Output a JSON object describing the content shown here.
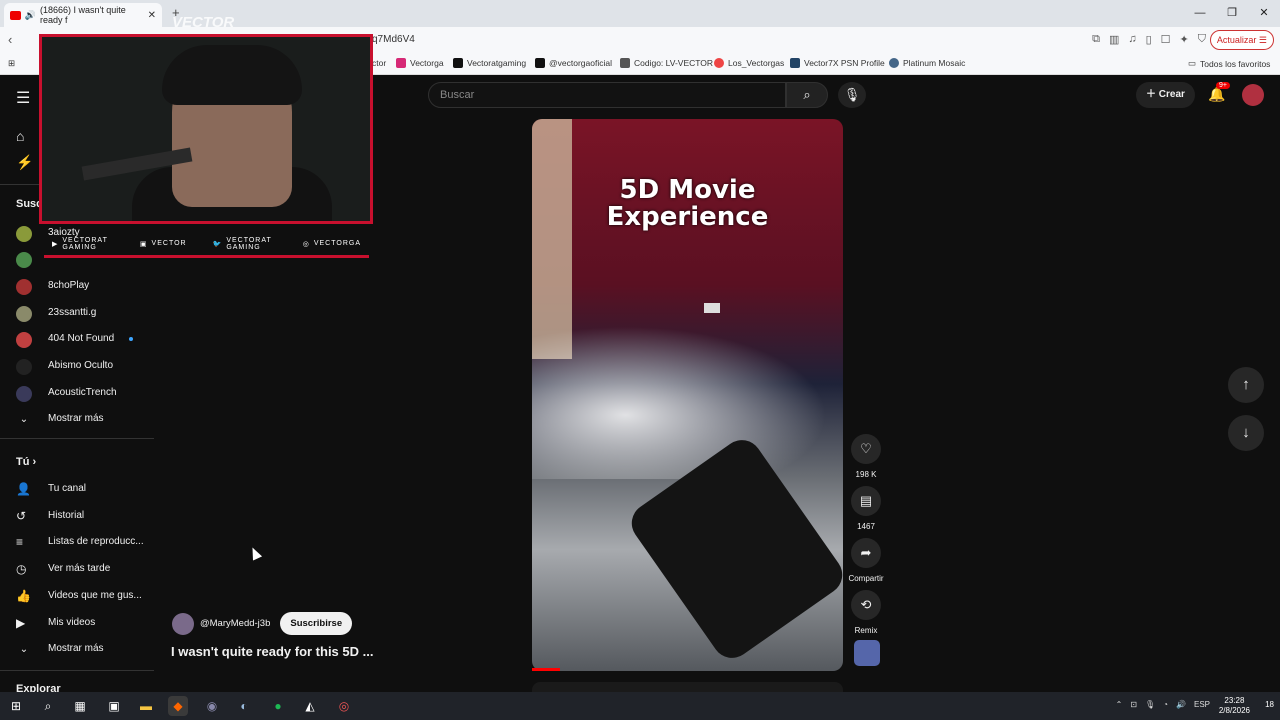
{
  "browser": {
    "tab_title": "(18666) I wasn't quite ready f",
    "url": "q7Md6V4",
    "update_label": "Actualizar",
    "bookmarks": [
      {
        "label": "ctor",
        "color": "#666"
      },
      {
        "label": "Vectorga",
        "color": "#d62976"
      },
      {
        "label": "Vectoratgaming",
        "color": "#111"
      },
      {
        "label": "@vectorgaoficial",
        "color": "#111"
      },
      {
        "label": "Codigo: LV-VECTOR",
        "color": "#222"
      },
      {
        "label": "Los_Vectorgas",
        "color": "#e44"
      },
      {
        "label": "Vector7X PSN Profile",
        "color": "#246"
      },
      {
        "label": "Platinum Mosaic",
        "color": "#468"
      }
    ],
    "favorites_label": "Todos los favoritos"
  },
  "youtube": {
    "search_placeholder": "Buscar",
    "create_label": "Crear",
    "notif_badge": "9+",
    "sidebar": {
      "subs_header": "Susc",
      "subscriptions": [
        {
          "label": "3aiozty",
          "color": "#8a9a3a"
        },
        {
          "label": "",
          "color": "#4a8a4a"
        },
        {
          "label": "8choPlay",
          "color": "#a03030"
        },
        {
          "label": "23ssantti.g",
          "color": "#8a8a6a"
        },
        {
          "label": "404 Not Found",
          "color": "#c04040"
        },
        {
          "label": "Abismo Oculto",
          "color": "#222"
        },
        {
          "label": "AcousticTrench",
          "color": "#3a3a5a"
        }
      ],
      "show_more_1": "Mostrar más",
      "you_header": "Tú",
      "you_items": [
        "Tu canal",
        "Historial",
        "Listas de reproducc...",
        "Ver más tarde",
        "Videos que me gus...",
        "Mis videos"
      ],
      "show_more_2": "Mostrar más",
      "explore_header": "Explorar"
    },
    "short": {
      "overlay_title_line1": "5D Movie",
      "overlay_title_line2": "Experience",
      "channel": "@MaryMedd-j3b",
      "subscribe_label": "Suscribirse",
      "video_title": "I wasn't quite ready for this 5D ...",
      "likes": "198 K",
      "comments": "1467",
      "share_label": "Compartir",
      "remix_label": "Remix"
    }
  },
  "overlay": {
    "watermark": "VECTOR",
    "socials": [
      "VECTORAT GAMING",
      "VECTOR",
      "VECTORAT GAMING",
      "VECTORGA"
    ]
  },
  "taskbar": {
    "lang": "ESP",
    "time": "23:28",
    "date": "2/8/2026",
    "notif_count": "18"
  }
}
